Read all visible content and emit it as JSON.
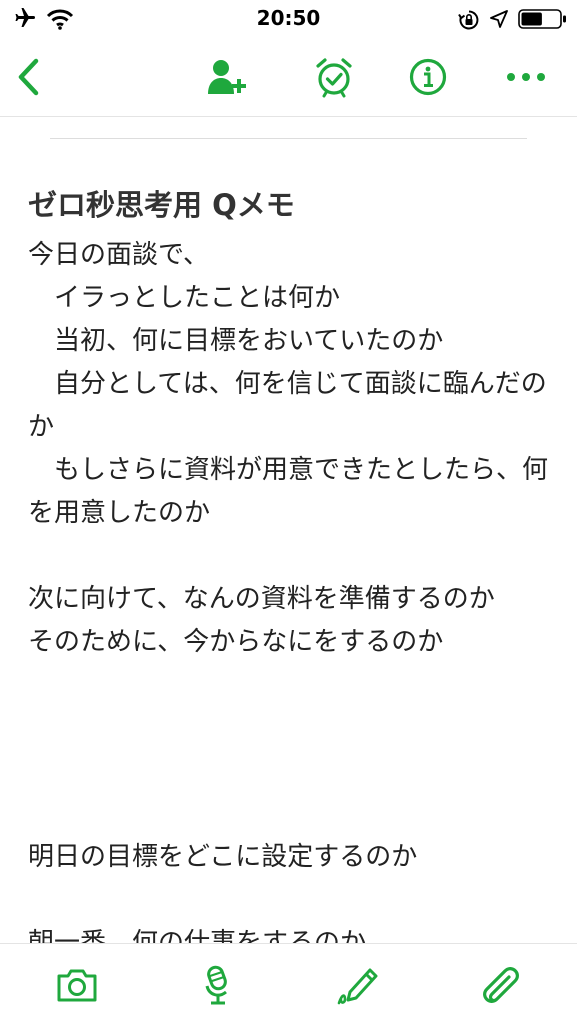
{
  "status_bar": {
    "time": "20:50",
    "left_icons": [
      "airplane-icon",
      "wifi-icon"
    ],
    "right_icons": [
      "orientation-lock-icon",
      "location-icon",
      "battery-icon"
    ],
    "battery_level": 0.55
  },
  "nav": {
    "back_icon": "chevron-left-icon",
    "actions": [
      "share-user-icon",
      "reminder-alarm-icon",
      "info-icon",
      "more-icon"
    ]
  },
  "note": {
    "title": "ゼロ秒思考用 Qメモ",
    "lines": [
      "今日の面談で、",
      "　イラっとしたことは何か",
      "　当初、何に目標をおいていたのか",
      "　自分としては、何を信じて面談に臨んだのか",
      "　もしさらに資料が用意できたとしたら、何を用意したのか",
      "",
      "次に向けて、なんの資料を準備するのか",
      "そのために、今からなにをするのか",
      "",
      "",
      "",
      "",
      "明日の目標をどこに設定するのか",
      "",
      "朝一番、何の仕事をするのか"
    ]
  },
  "toolbar": {
    "items": [
      "camera-icon",
      "microphone-icon",
      "handwriting-pen-icon",
      "attachment-paperclip-icon"
    ]
  },
  "colors": {
    "accent": "#1fa83d",
    "text": "#222222",
    "title": "#333333"
  }
}
